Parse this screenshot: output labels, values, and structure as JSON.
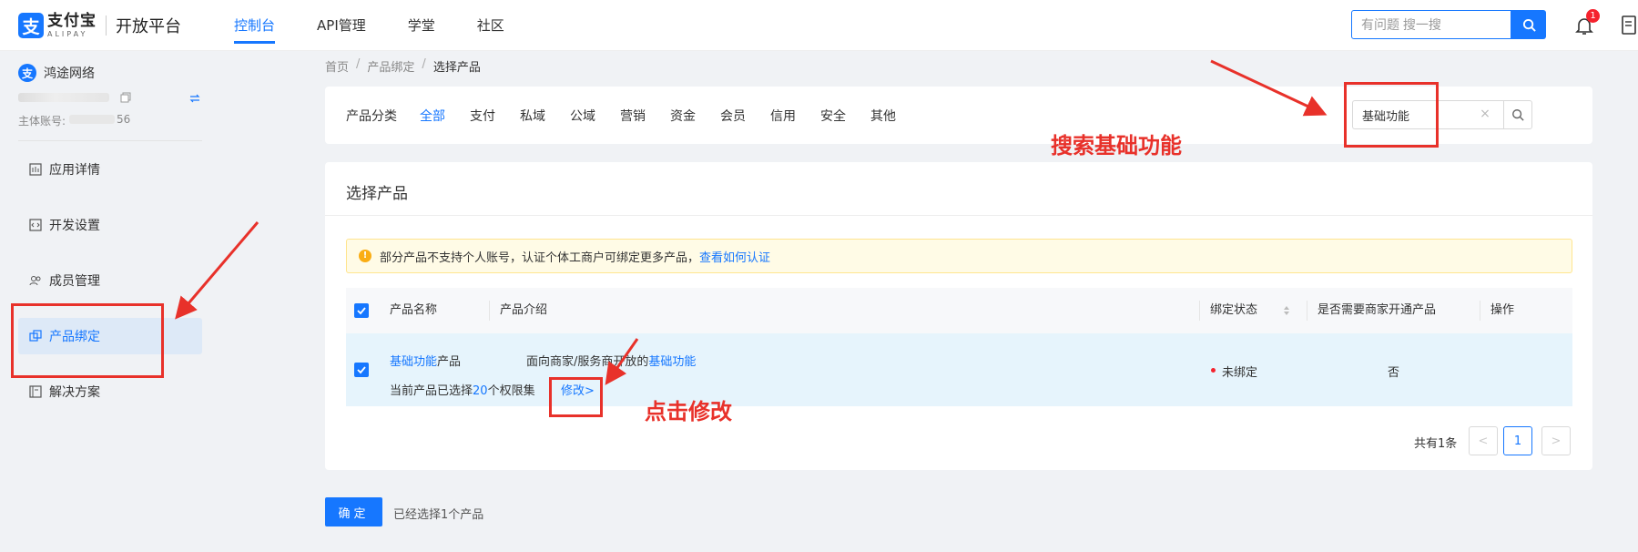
{
  "header": {
    "logo_cn": "支付宝",
    "logo_en": "ALIPAY",
    "logo_mark": "支",
    "platform_title": "开放平台",
    "nav": [
      {
        "label": "控制台",
        "active": true
      },
      {
        "label": "API管理",
        "active": false
      },
      {
        "label": "学堂",
        "active": false
      },
      {
        "label": "社区",
        "active": false
      }
    ],
    "search_placeholder": "有问题 搜一搜",
    "notification_count": "1"
  },
  "sidebar": {
    "app_icon": "支",
    "app_name": "鸿途网络",
    "account_label": "主体账号:",
    "account_tail": "56",
    "items": [
      {
        "label": "应用详情",
        "icon": "grid-icon",
        "active": false
      },
      {
        "label": "开发设置",
        "icon": "code-icon",
        "active": false
      },
      {
        "label": "成员管理",
        "icon": "users-icon",
        "active": false
      },
      {
        "label": "产品绑定",
        "icon": "link-icon",
        "active": true
      },
      {
        "label": "解决方案",
        "icon": "doc-icon",
        "active": false
      }
    ]
  },
  "breadcrumb": [
    "首页",
    "产品绑定",
    "选择产品"
  ],
  "filter": {
    "label": "产品分类",
    "categories": [
      {
        "label": "全部",
        "active": true
      },
      {
        "label": "支付",
        "active": false
      },
      {
        "label": "私域",
        "active": false
      },
      {
        "label": "公域",
        "active": false
      },
      {
        "label": "营销",
        "active": false
      },
      {
        "label": "资金",
        "active": false
      },
      {
        "label": "会员",
        "active": false
      },
      {
        "label": "信用",
        "active": false
      },
      {
        "label": "安全",
        "active": false
      },
      {
        "label": "其他",
        "active": false
      }
    ],
    "search_value": "基础功能",
    "clear_glyph": "×"
  },
  "card": {
    "title": "选择产品",
    "notice_text": "部分产品不支持个人账号，认证个体工商户可绑定更多产品，",
    "notice_link": "查看如何认证",
    "notice_icon": "!",
    "columns": {
      "name": "产品名称",
      "intro": "产品介绍",
      "status": "绑定状态",
      "merchant": "是否需要商家开通产品",
      "action": "操作"
    },
    "row": {
      "name_highlight": "基础功能",
      "name_suffix": "产品",
      "perm_prefix": "当前产品已选择",
      "perm_count": "20",
      "perm_suffix": "个权限集",
      "modify_link": "修改>",
      "intro_prefix": "面向商家/服务商开放的",
      "intro_highlight": "基础功能",
      "status": "未绑定",
      "merchant_required": "否"
    },
    "pager": {
      "total_text": "共有1条",
      "prev": "<",
      "current": "1",
      "next": ">"
    }
  },
  "footer": {
    "confirm_label": "确定",
    "selected_text": "已经选择1个产品"
  },
  "annotations": {
    "search_tip": "搜索基础功能",
    "modify_tip": "点击修改"
  },
  "colors": {
    "primary": "#1677ff",
    "annotation": "#e8312a",
    "status_unbound": "#f5222d"
  }
}
